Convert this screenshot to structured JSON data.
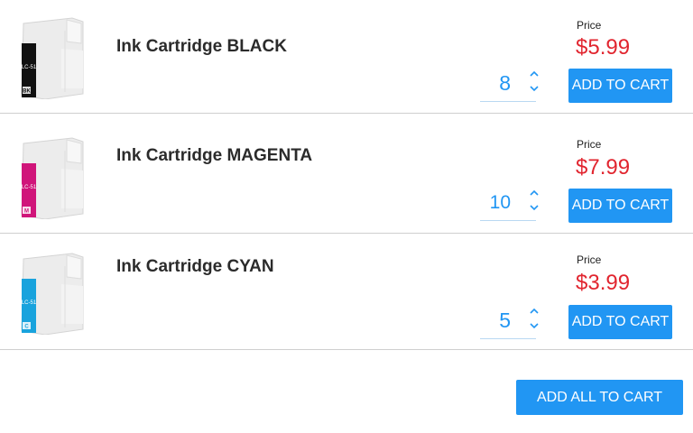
{
  "colors": {
    "accent": "#2196f3",
    "price": "#e1252f",
    "divider": "#cfcfcf"
  },
  "products": [
    {
      "name": "Ink Cartridge BLACK",
      "quantity": "8",
      "price_label": "Price",
      "price": "$5.99",
      "button_label": "ADD TO CART",
      "image_icon": "ink-cartridge-black",
      "ink_color": "#111111",
      "cartridge_label": "LC-51",
      "cartridge_badge": "BK"
    },
    {
      "name": "Ink Cartridge MAGENTA",
      "quantity": "10",
      "price_label": "Price",
      "price": "$7.99",
      "button_label": "ADD TO CART",
      "image_icon": "ink-cartridge-magenta",
      "ink_color": "#d0157a",
      "cartridge_label": "LC-51",
      "cartridge_badge": "M"
    },
    {
      "name": "Ink Cartridge CYAN",
      "quantity": "5",
      "price_label": "Price",
      "price": "$3.99",
      "button_label": "ADD TO CART",
      "image_icon": "ink-cartridge-cyan",
      "ink_color": "#19a3dd",
      "cartridge_label": "LC-51",
      "cartridge_badge": "C"
    }
  ],
  "footer": {
    "add_all_label": "ADD ALL TO CART"
  }
}
